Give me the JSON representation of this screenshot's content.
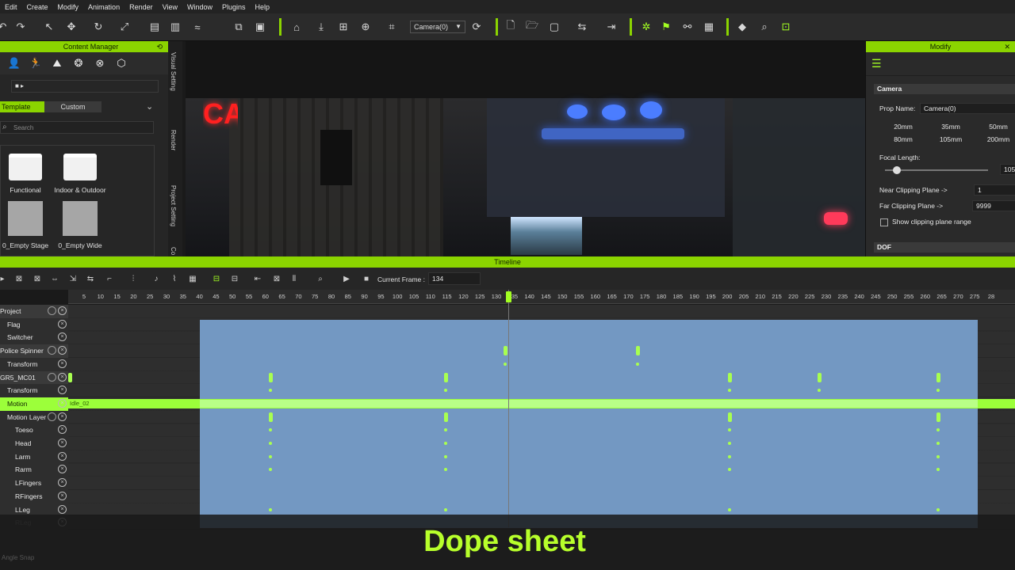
{
  "menu": [
    "Edit",
    "Create",
    "Modify",
    "Animation",
    "Render",
    "View",
    "Window",
    "Plugins",
    "Help"
  ],
  "toolbar": {
    "camera_select": "Camera(0)"
  },
  "content_manager": {
    "title": "Content Manager",
    "tabs": {
      "template": "Template",
      "custom": "Custom"
    },
    "search_placeholder": "Search",
    "items": [
      {
        "label": "Functional",
        "icon": "folder-icon"
      },
      {
        "label": "Indoor & Outdoor",
        "icon": "folder-icon"
      },
      {
        "label": "0_Empty Stage",
        "icon": "stage-thumb"
      },
      {
        "label": "0_Empty Wide",
        "icon": "stage-thumb"
      }
    ],
    "side_tabs": [
      "Visual Setting",
      "Render",
      "Project Setting",
      "Co"
    ]
  },
  "viewport": {
    "sign_text": "CADE"
  },
  "modify": {
    "title": "Modify",
    "section_camera": "Camera",
    "prop_name_label": "Prop Name:",
    "prop_name_value": "Camera(0)",
    "lens_presets": [
      "20mm",
      "35mm",
      "50mm",
      "80mm",
      "105mm",
      "200mm"
    ],
    "focal_length_label": "Focal Length:",
    "focal_length_value": "105",
    "near_label": "Near Clipping Plane ->",
    "near_value": "1",
    "far_label": "Far Clipping Plane ->",
    "far_value": "9999",
    "show_clip_label": "Show clipping plane range",
    "section_dof": "DOF"
  },
  "timeline": {
    "title": "Timeline",
    "current_frame_label": "Current Frame :",
    "current_frame_value": "134",
    "ruler_ticks": [
      "5",
      "10",
      "15",
      "20",
      "25",
      "30",
      "35",
      "40",
      "45",
      "50",
      "55",
      "60",
      "65",
      "70",
      "75",
      "80",
      "85",
      "90",
      "95",
      "100",
      "105",
      "110",
      "115",
      "120",
      "125",
      "130",
      "135",
      "140",
      "145",
      "150",
      "155",
      "160",
      "165",
      "170",
      "175",
      "180",
      "185",
      "190",
      "195",
      "200",
      "205",
      "210",
      "215",
      "220",
      "225",
      "230",
      "235",
      "240",
      "245",
      "250",
      "255",
      "260",
      "265",
      "270",
      "275",
      "28"
    ],
    "tracks": [
      {
        "label": "Project",
        "indent": 0
      },
      {
        "label": "Flag",
        "indent": 1
      },
      {
        "label": "Switcher",
        "indent": 1
      },
      {
        "label": "Police Spinner",
        "indent": 0
      },
      {
        "label": "Transform",
        "indent": 1
      },
      {
        "label": "GR5_MC01",
        "indent": 0
      },
      {
        "label": "Transform",
        "indent": 1
      },
      {
        "label": "Motion",
        "indent": 1
      },
      {
        "label": "Motion Layer",
        "indent": 1
      },
      {
        "label": "Toeso",
        "indent": 2
      },
      {
        "label": "Head",
        "indent": 2
      },
      {
        "label": "Larm",
        "indent": 2
      },
      {
        "label": "Rarm",
        "indent": 2
      },
      {
        "label": "LFingers",
        "indent": 2
      },
      {
        "label": "RFingers",
        "indent": 2
      },
      {
        "label": "LLeg",
        "indent": 2
      },
      {
        "label": "RLeg",
        "indent": 2
      }
    ],
    "motion_clip_label": "Idle_02"
  },
  "caption": "Dope sheet",
  "status_text": "Angle Snap"
}
